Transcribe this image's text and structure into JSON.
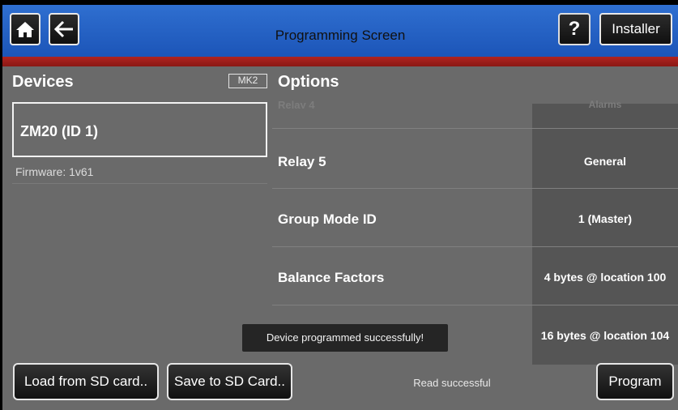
{
  "header": {
    "title": "Programming Screen",
    "home_icon": "home-icon",
    "back_icon": "arrow-left-icon",
    "help_label": "?",
    "installer_label": "Installer",
    "colors": {
      "bar": "#1f5cc0",
      "stripe": "#9a1c17"
    }
  },
  "devices": {
    "title": "Devices",
    "badge": "MK2",
    "items": [
      {
        "name": "ZM20 (ID 1)",
        "firmware": "Firmware: 1v61"
      }
    ]
  },
  "options": {
    "title": "Options",
    "rows": [
      {
        "label": "Relay 4",
        "value": "Alarms"
      },
      {
        "label": "Relay 5",
        "value": "General"
      },
      {
        "label": "Group Mode ID",
        "value": "1 (Master)"
      },
      {
        "label": "Balance Factors",
        "value": "4 bytes @ location 100"
      },
      {
        "label": "",
        "value": "16 bytes @ location 104"
      }
    ]
  },
  "toast": "Device programmed successfully!",
  "footer": {
    "load_label": "Load from SD card..",
    "save_label": "Save to SD Card..",
    "status": "Read successful",
    "program_label": "Program"
  }
}
